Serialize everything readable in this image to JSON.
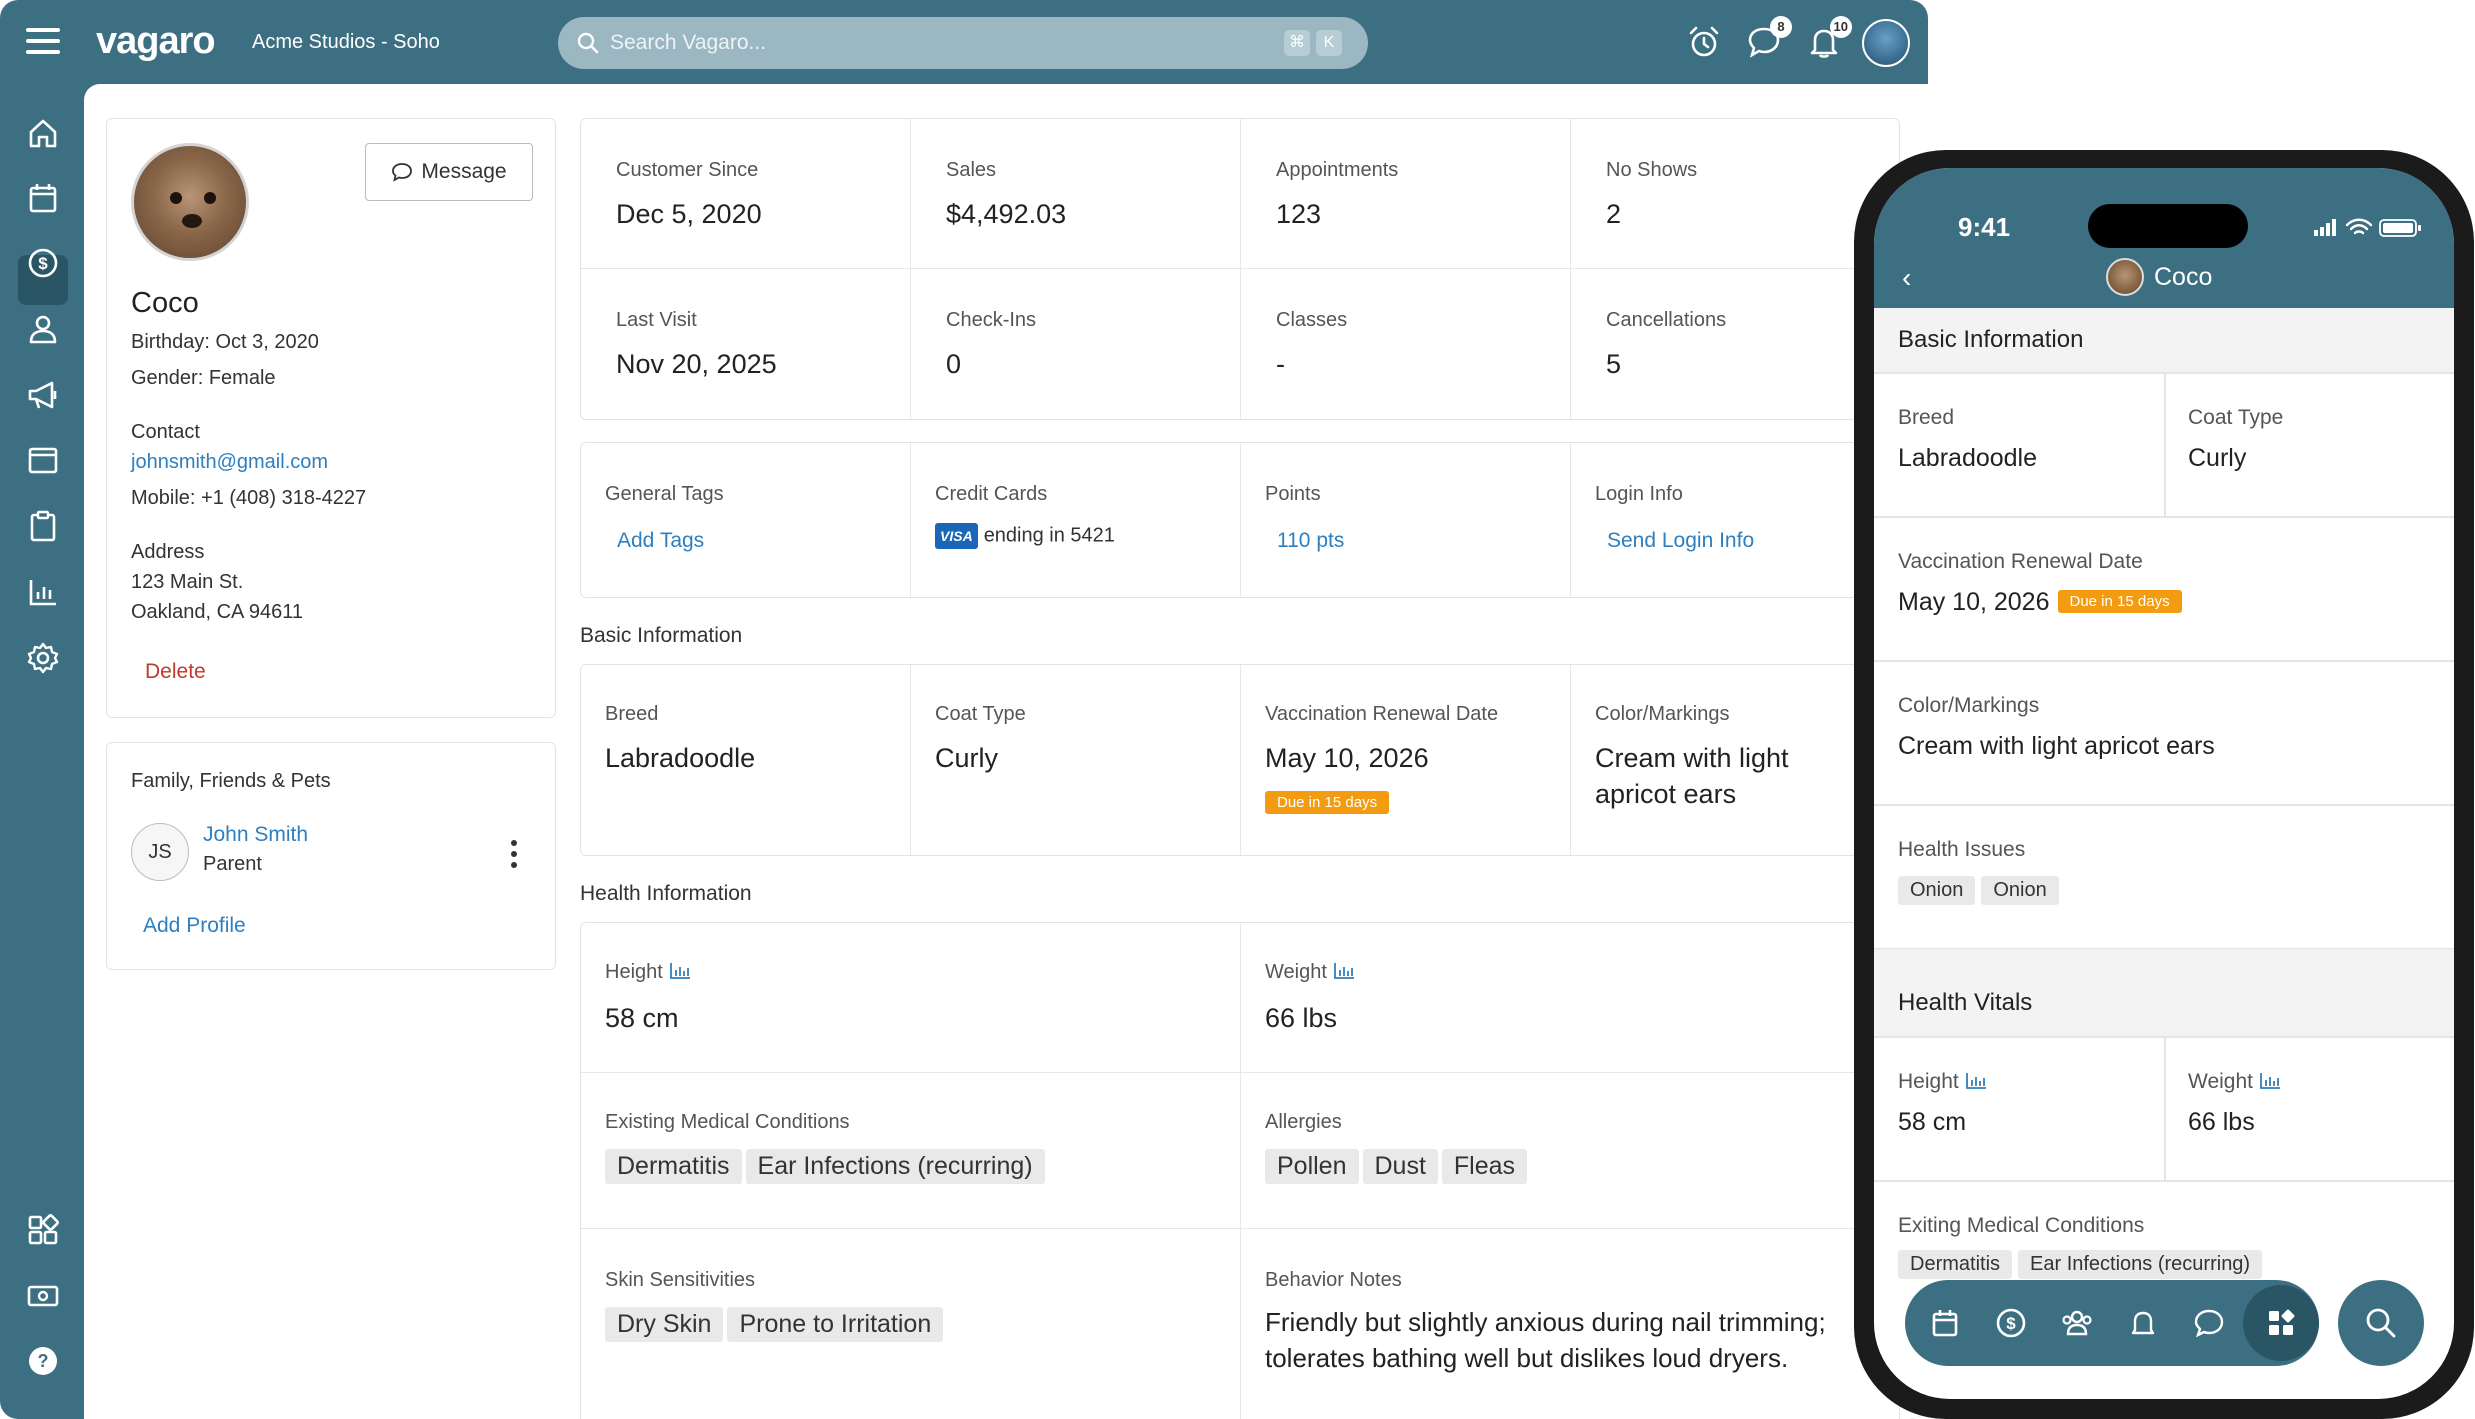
{
  "app": {
    "logo": "vagaro",
    "business": "Acme Studios - Soho",
    "search_placeholder": "Search Vagaro...",
    "shortcut_keys": [
      "⌘",
      "K"
    ],
    "messages_badge": "8",
    "notifications_badge": "10"
  },
  "colors": {
    "brand": "#3d6f82",
    "link": "#2e7fc0",
    "danger": "#c0392b",
    "warning": "#f39c12"
  },
  "sidebar_icons": [
    "home-icon",
    "calendar-icon",
    "dollar-icon",
    "user-icon",
    "megaphone-icon",
    "window-icon",
    "clipboard-icon",
    "bar-chart-icon",
    "gear-icon",
    "apps-icon",
    "cash-icon",
    "help-icon"
  ],
  "profile": {
    "message_label": "Message",
    "name": "Coco",
    "birthday": "Birthday: Oct 3, 2020",
    "gender": "Gender: Female",
    "contact_label": "Contact",
    "email": "johnsmith@gmail.com",
    "mobile": "Mobile: +1 (408) 318-4227",
    "address_label": "Address",
    "address_line1": "123 Main St.",
    "address_line2": "Oakland, CA 94611",
    "delete_label": "Delete"
  },
  "family": {
    "title": "Family, Friends & Pets",
    "member_initials": "JS",
    "member_name": "John Smith",
    "member_relation": "Parent",
    "add_profile_label": "Add Profile"
  },
  "stats": [
    {
      "label": "Customer Since",
      "value": "Dec 5, 2020"
    },
    {
      "label": "Sales",
      "value": "$4,492.03"
    },
    {
      "label": "Appointments",
      "value": "123"
    },
    {
      "label": "No Shows",
      "value": "2"
    },
    {
      "label": "Last Visit",
      "value": "Nov 20, 2025"
    },
    {
      "label": "Check-Ins",
      "value": "0"
    },
    {
      "label": "Classes",
      "value": "-"
    },
    {
      "label": "Cancellations",
      "value": "5"
    }
  ],
  "info": {
    "general_tags_label": "General Tags",
    "add_tags_label": "Add Tags",
    "credit_cards_label": "Credit Cards",
    "card_brand": "VISA",
    "card_text": "ending in 5421",
    "points_label": "Points",
    "points_value": "110 pts",
    "login_label": "Login Info",
    "send_login_label": "Send Login Info"
  },
  "basic": {
    "section_title": "Basic Information",
    "breed_label": "Breed",
    "breed": "Labradoodle",
    "coat_label": "Coat Type",
    "coat": "Curly",
    "vacc_label": "Vaccination Renewal Date",
    "vacc_date": "May 10, 2026",
    "vacc_due": "Due in 15 days",
    "color_label": "Color/Markings",
    "color_line1": "Cream with light",
    "color_line2": "apricot ears"
  },
  "health": {
    "section_title": "Health Information",
    "height_label": "Height",
    "height": "58 cm",
    "weight_label": "Weight",
    "weight": "66 lbs",
    "conditions_label": "Existing Medical Conditions",
    "conditions": [
      "Dermatitis",
      "Ear Infections (recurring)"
    ],
    "allergies_label": "Allergies",
    "allergies": [
      "Pollen",
      "Dust",
      "Fleas"
    ],
    "skin_label": "Skin Sensitivities",
    "skin": [
      "Dry Skin",
      "Prone to Irritation"
    ],
    "behavior_label": "Behavior Notes",
    "behavior_line1": "Friendly but slightly anxious during nail trimming;",
    "behavior_line2": "tolerates bathing well but dislikes loud dryers."
  },
  "phone": {
    "time": "9:41",
    "title": "Coco",
    "basic_title": "Basic Information",
    "breed_label": "Breed",
    "breed": "Labradoodle",
    "coat_label": "Coat Type",
    "coat": "Curly",
    "vacc_label": "Vaccination Renewal Date",
    "vacc_date": "May 10, 2026",
    "vacc_due": "Due in 15 days",
    "color_label": "Color/Markings",
    "color": "Cream with light apricot ears",
    "issues_label": "Health Issues",
    "issues": [
      "Onion",
      "Onion"
    ],
    "vitals_title": "Health Vitals",
    "height_label": "Height",
    "height": "58 cm",
    "weight_label": "Weight",
    "weight": "66 lbs",
    "conditions_label": "Exiting Medical Conditions",
    "conditions": [
      "Dermatitis",
      "Ear Infections (recurring)"
    ]
  }
}
